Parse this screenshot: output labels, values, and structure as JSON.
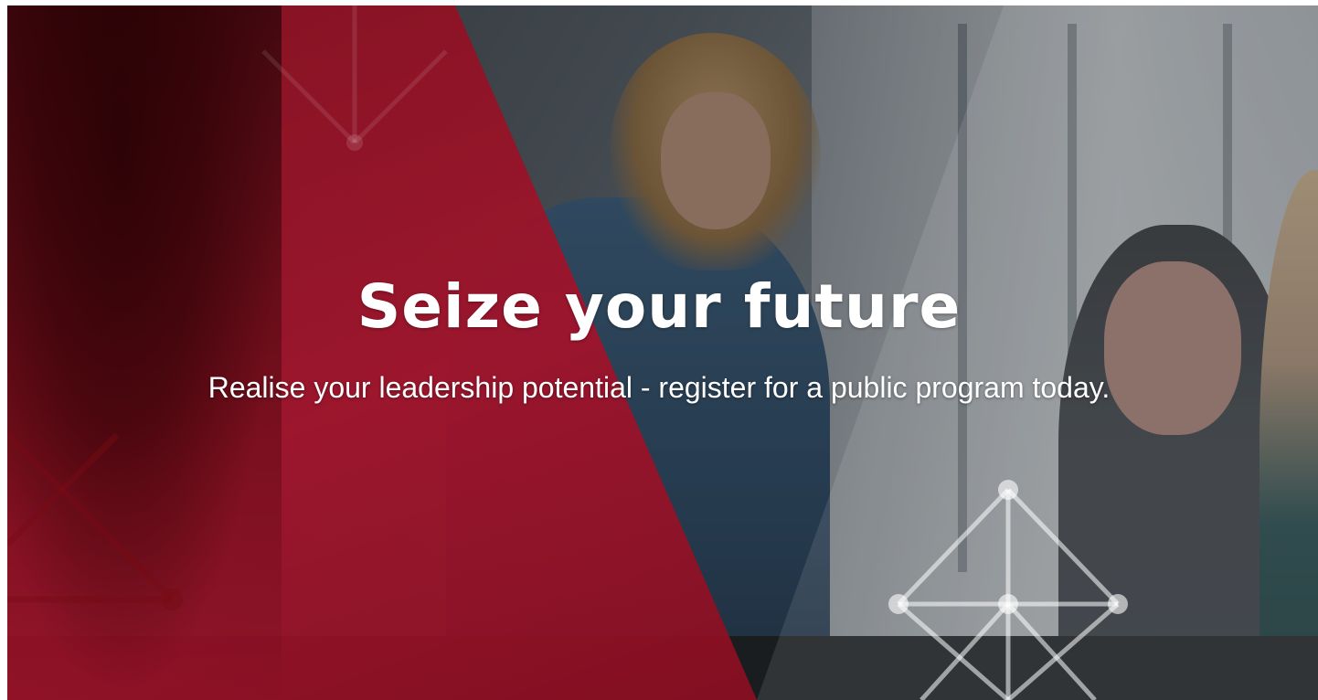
{
  "hero": {
    "headline": "Seize your future",
    "subheadline": "Realise your leadership potential - register for a public program today."
  },
  "colors": {
    "overlay_red": "#a4122a",
    "text": "#ffffff"
  },
  "icons": [
    "network-diagram-icon"
  ]
}
